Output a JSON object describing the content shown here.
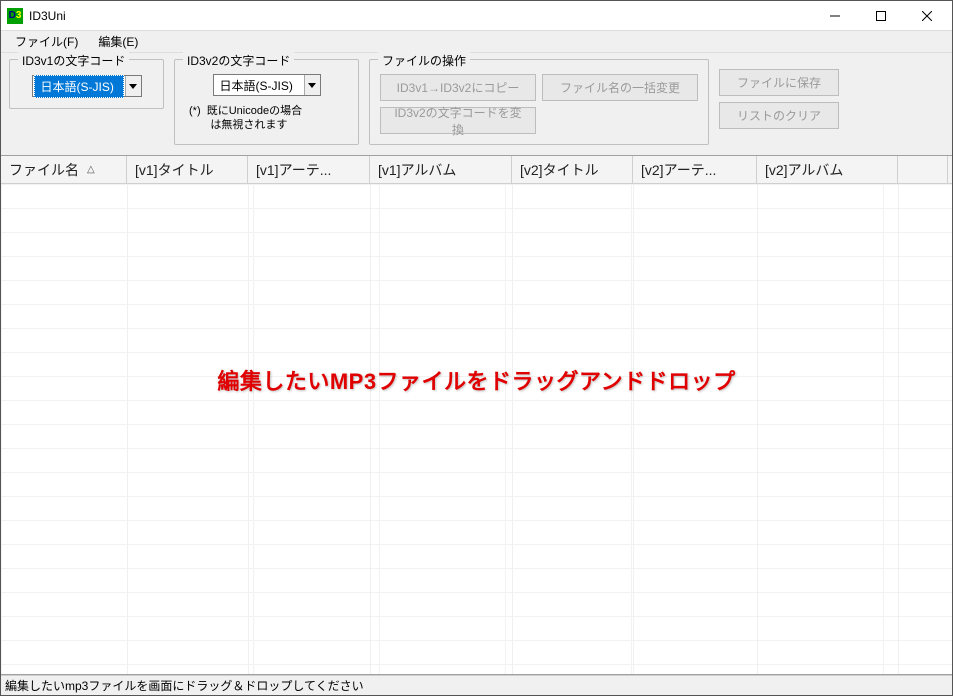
{
  "window": {
    "title": "ID3Uni"
  },
  "menu": {
    "file": "ファイル(F)",
    "edit": "編集(E)"
  },
  "groups": {
    "id3v1": {
      "legend": "ID3v1の文字コード",
      "combo": "日本語(S-JIS)"
    },
    "id3v2": {
      "legend": "ID3v2の文字コード",
      "combo": "日本語(S-JIS)",
      "note": "(*)  既にUnicodeの場合\n       は無視されます"
    },
    "fileops": {
      "legend": "ファイルの操作",
      "btn_copy": "ID3v1→ID3v2にコピー",
      "btn_rename": "ファイル名の一括変更",
      "btn_convert": "ID3v2の文字コードを変換"
    }
  },
  "buttons": {
    "save": "ファイルに保存",
    "clear": "リストのクリア"
  },
  "columns": {
    "c0": "ファイル名",
    "sort_asc": "△",
    "c1": "[v1]タイトル",
    "c2": "[v1]アーテ...",
    "c3": "[v1]アルバム",
    "c4": "[v2]タイトル",
    "c5": "[v2]アーテ...",
    "c6": "[v2]アルバム"
  },
  "overlay": "編集したいMP3ファイルをドラッグアンドドロップ",
  "status": "編集したいmp3ファイルを画面にドラッグ＆ドロップしてください"
}
